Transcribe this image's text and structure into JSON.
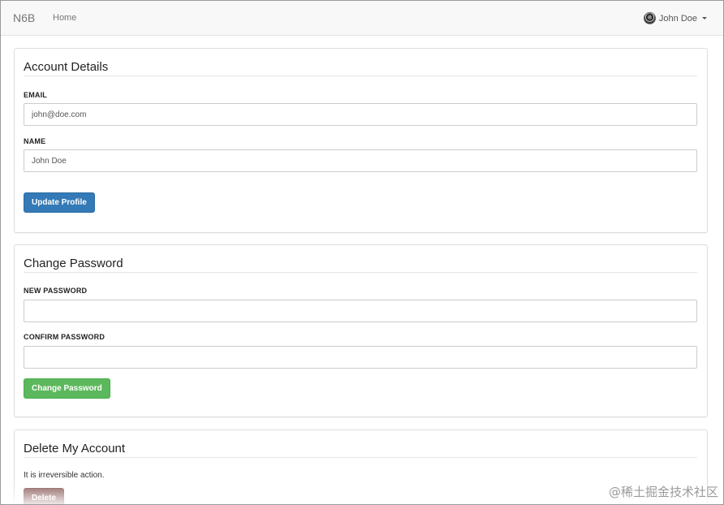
{
  "navbar": {
    "brand": "N6B",
    "links": [
      "Home"
    ],
    "user_name": "John Doe"
  },
  "account_details": {
    "title": "Account Details",
    "email_label": "EMAIL",
    "email_value": "john@doe.com",
    "name_label": "NAME",
    "name_value": "John Doe",
    "update_button": "Update Profile"
  },
  "change_password": {
    "title": "Change Password",
    "new_label": "NEW PASSWORD",
    "new_value": "",
    "confirm_label": "CONFIRM PASSWORD",
    "confirm_value": "",
    "change_button": "Change Password"
  },
  "delete_account": {
    "title": "Delete My Account",
    "note": "It is irreversible action.",
    "delete_button": "Delete"
  },
  "watermark": "@稀土掘金技术社区",
  "colors": {
    "primary": "#337ab7",
    "success": "#5cb85c",
    "danger": "#8c5f5d",
    "navbar_bg": "#f8f8f8"
  },
  "icons": {
    "avatar": "user-avatar-icon",
    "dropdown": "caret-down-icon"
  }
}
